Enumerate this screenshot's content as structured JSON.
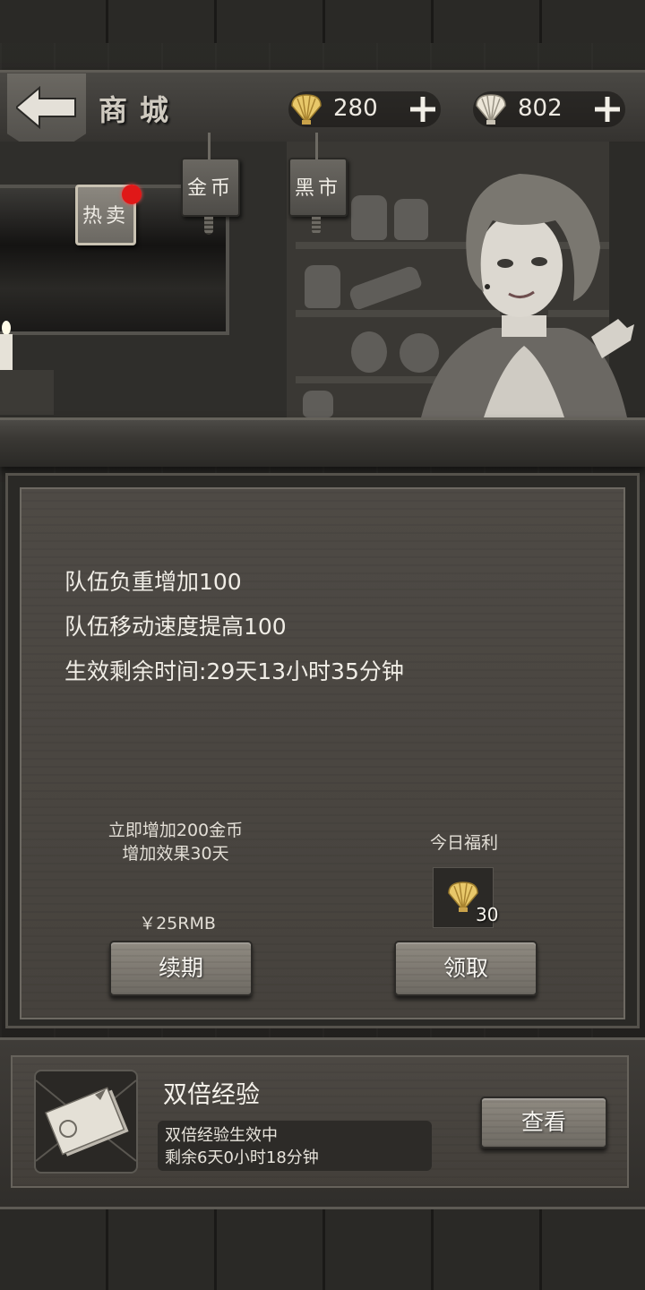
{
  "header": {
    "title": "商城",
    "currencies": [
      {
        "icon": "shell-icon",
        "amount": "280"
      },
      {
        "icon": "shell-icon",
        "amount": "802"
      }
    ]
  },
  "tabs": [
    {
      "label": "热卖",
      "active": true,
      "badge": "red-dot"
    },
    {
      "label": "金币",
      "active": false
    },
    {
      "label": "黑市",
      "active": false
    }
  ],
  "card": {
    "effects": [
      "队伍负重增加100",
      "队伍移动速度提高100",
      "生效剩余时间:29天13小时35分钟"
    ],
    "offer_line1": "立即增加200金币",
    "offer_line2": "增加效果30天",
    "price": "￥25RMB",
    "renew_label": "续期",
    "daily_title": "今日福利",
    "daily_reward_icon": "shell-icon",
    "daily_reward_count": "30",
    "claim_label": "领取"
  },
  "double_exp": {
    "icon": "exp-x2-ticket-icon",
    "title": "双倍经验",
    "status": "双倍经验生效中",
    "remaining": "剩余6天0小时18分钟",
    "view_label": "查看"
  },
  "colors": {
    "background": "#2b2a27",
    "panel": "#4a4641",
    "button": "#7e7a72",
    "badge": "#e01818",
    "shell": "#e8c86a"
  }
}
